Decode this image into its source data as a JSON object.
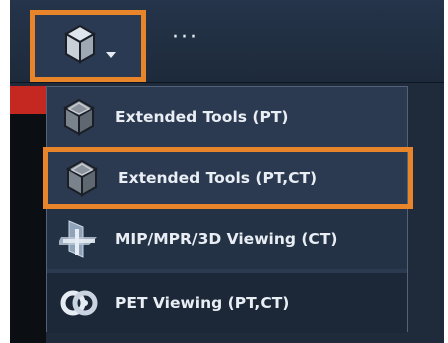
{
  "toolbar": {
    "tool_icon": "cube-icon",
    "dropdown_icon": "caret-down-icon",
    "more_label": "···"
  },
  "menu": {
    "items": [
      {
        "label": "Extended Tools (PT)",
        "icon": "cube-icon",
        "highlighted": false
      },
      {
        "label": "Extended Tools (PT,CT)",
        "icon": "cube-icon",
        "highlighted": true
      },
      {
        "label": "MIP/MPR/3D Viewing (CT)",
        "icon": "mpr-planes-icon",
        "highlighted": false
      },
      {
        "label": "PET Viewing (PT,CT)",
        "icon": "pet-rings-icon",
        "highlighted": false
      }
    ]
  },
  "colors": {
    "highlight": "#e8842a",
    "menu_background": "#2b3a50",
    "toolbar_background": "#25344a",
    "text": "#e9eef5"
  }
}
